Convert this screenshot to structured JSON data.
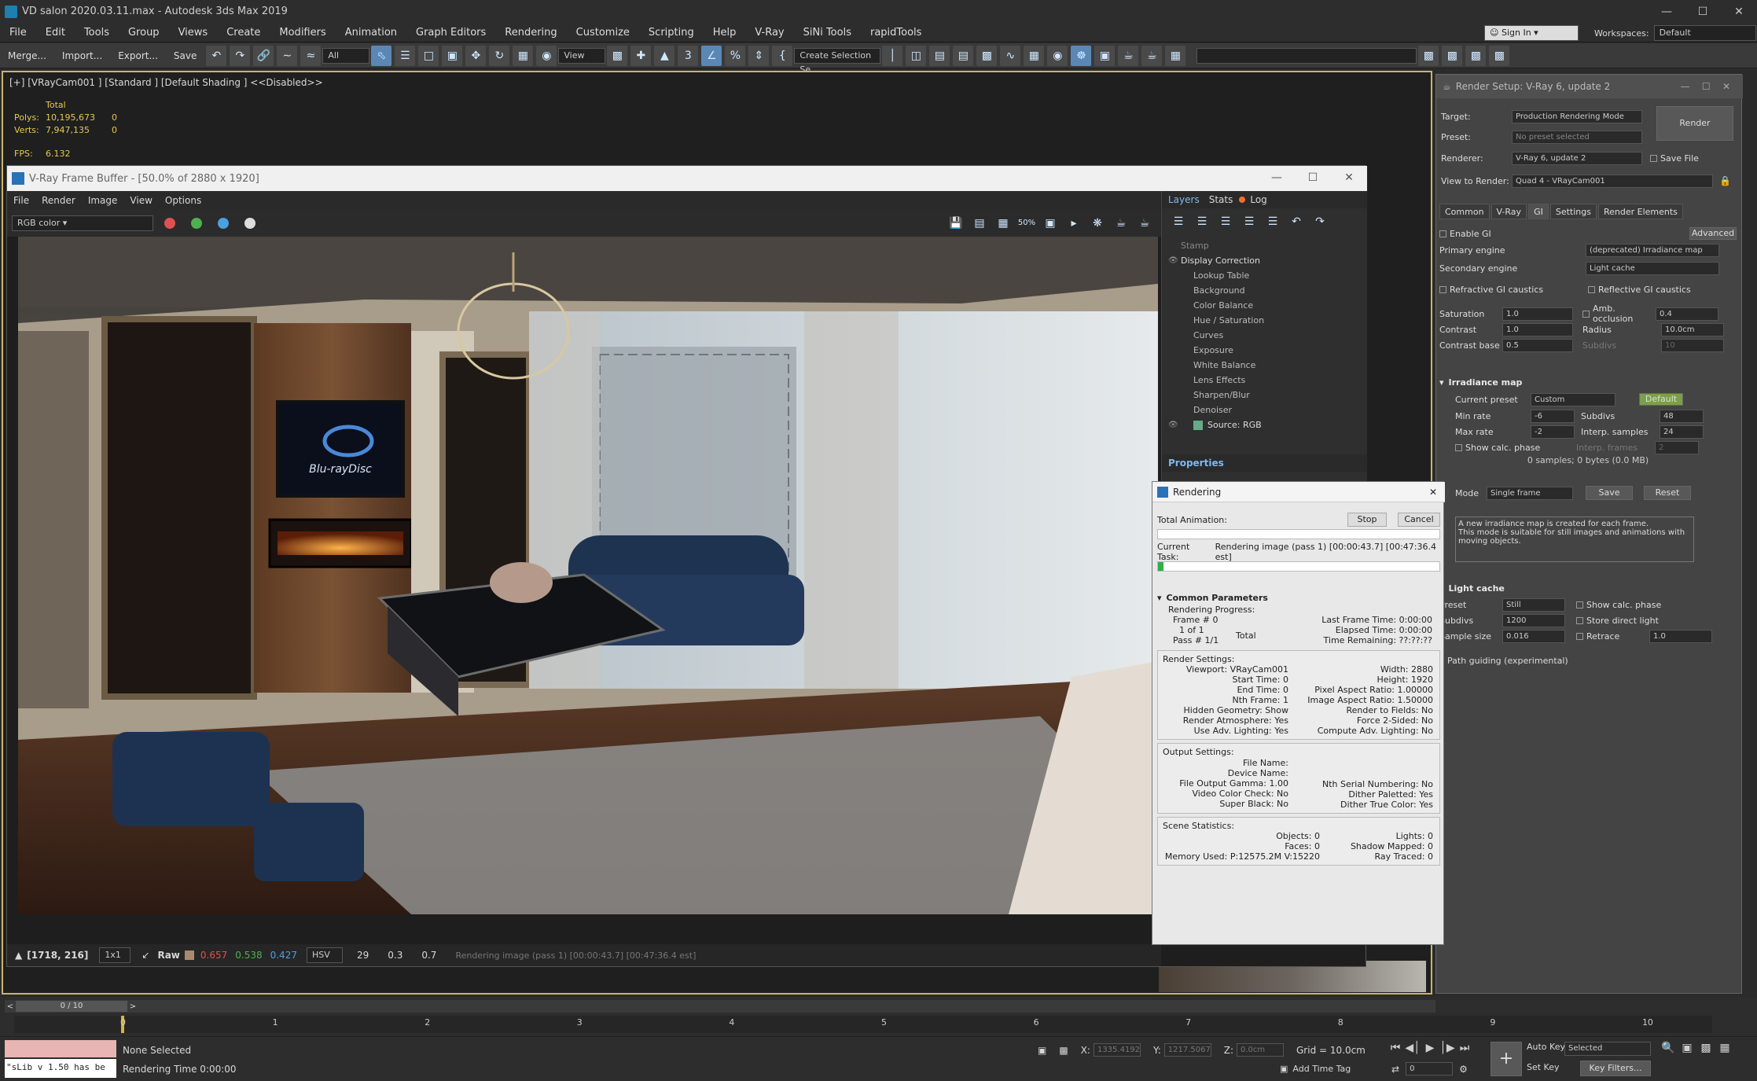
{
  "window": {
    "title": "VD salon 2020.03.11.max - Autodesk 3ds Max 2019",
    "controls": [
      "—",
      "☐",
      "✕"
    ]
  },
  "menu": [
    "File",
    "Edit",
    "Tools",
    "Group",
    "Views",
    "Create",
    "Modifiers",
    "Animation",
    "Graph Editors",
    "Rendering",
    "Customize",
    "Scripting",
    "Help",
    "V-Ray",
    "SiNi Tools",
    "rapidTools"
  ],
  "account": {
    "signin": "Sign In",
    "workspaces_label": "Workspaces:",
    "workspace": "Default"
  },
  "toolbar": {
    "merge": "Merge...",
    "import": "Import...",
    "export": "Export...",
    "save": "Save",
    "filter": "All",
    "refcoord": "View",
    "selset": "Create Selection Se"
  },
  "viewport": {
    "label": "[+] [VRayCam001 ] [Standard ] [Default Shading ]  <<Disabled>>",
    "stats": {
      "total": "Total",
      "polys_label": "Polys:",
      "polys": "10,195,673",
      "polys_sel": "0",
      "verts_label": "Verts:",
      "verts": "7,947,135",
      "verts_sel": "0",
      "fps_label": "FPS:",
      "fps": "6.132"
    }
  },
  "vfb": {
    "title": "V-Ray Frame Buffer - [50.0% of 2880 x 1920]",
    "menu": [
      "File",
      "Render",
      "Image",
      "View",
      "Options"
    ],
    "channel": "RGB color",
    "layer_tabs": [
      "Layers",
      "Stats",
      "Log"
    ],
    "layers": [
      "Stamp",
      "Display Correction",
      "Lookup Table",
      "Background",
      "Color Balance",
      "Hue / Saturation",
      "Curves",
      "Exposure",
      "White Balance",
      "Lens Effects",
      "Sharpen/Blur",
      "Denoiser",
      "Source: RGB"
    ],
    "properties": "Properties",
    "status": {
      "coords": "[1718, 216]",
      "zoom": "1x1",
      "mode": "Raw",
      "r": "0.657",
      "g": "0.538",
      "b": "0.427",
      "space": "HSV",
      "h": "29",
      "s": "0.3",
      "v": "0.7",
      "msg": "Rendering image (pass 1) [00:00:43.7] [00:47:36.4 est]"
    },
    "tv_text": "Blu-rayDisc"
  },
  "render_setup": {
    "title": "Render Setup: V-Ray 6, update 2",
    "target_label": "Target:",
    "target": "Production Rendering Mode",
    "preset_label": "Preset:",
    "preset": "No preset selected",
    "renderer_label": "Renderer:",
    "renderer": "V-Ray 6, update 2",
    "savefile": "Save File",
    "view_label": "View to Render:",
    "view": "Quad 4 - VRayCam001",
    "render_btn": "Render",
    "tabs": [
      "Common",
      "V-Ray",
      "GI",
      "Settings",
      "Render Elements"
    ],
    "gi": {
      "enable": "Enable GI",
      "advanced": "Advanced",
      "primary_label": "Primary engine",
      "primary": "(deprecated) Irradiance map",
      "secondary_label": "Secondary engine",
      "secondary": "Light cache",
      "refr": "Refractive GI caustics",
      "refl": "Reflective GI caustics",
      "saturation_label": "Saturation",
      "saturation": "1.0",
      "amb": "Amb. occlusion",
      "amb_val": "0.4",
      "contrast_label": "Contrast",
      "contrast": "1.0",
      "radius_label": "Radius",
      "radius": "10.0cm",
      "cbase_label": "Contrast base",
      "cbase": "0.5",
      "subdivs_dim": "Subdivs",
      "subdivs_dim_val": "10"
    },
    "irr": {
      "title": "Irradiance map",
      "preset_label": "Current preset",
      "preset": "Custom",
      "default": "Default",
      "min_label": "Min rate",
      "min": "-6",
      "subdivs_label": "Subdivs",
      "subdivs": "48",
      "max_label": "Max rate",
      "max": "-2",
      "interp_label": "Interp. samples",
      "interp": "24",
      "showcalc": "Show calc. phase",
      "frames_label": "Interp. frames",
      "frames": "2",
      "samples": "0 samples; 0 bytes (0.0 MB)",
      "mode_label": "Mode",
      "mode": "Single frame",
      "save": "Save",
      "reset": "Reset",
      "desc": "A new irradiance map is created for each frame.\nThis mode is suitable for still images and animations with moving objects."
    },
    "lc": {
      "title": "Light cache",
      "preset_label": "Preset",
      "preset": "Still",
      "showcalc": "Show calc. phase",
      "subdivs_label": "Subdivs",
      "subdivs": "1200",
      "store": "Store direct light",
      "size_label": "Sample size",
      "size": "0.016",
      "retrace": "Retrace",
      "retrace_val": "1.0"
    },
    "pathguide": "Path guiding (experimental)"
  },
  "rendering": {
    "title": "Rendering",
    "total_anim": "Total Animation:",
    "stop": "Stop",
    "cancel": "Cancel",
    "current_task_label": "Current Task:",
    "current_task": "Rendering image (pass 1) [00:00:43.7] [00:47:36.4 est]",
    "progress": 0.02,
    "common": "Common Parameters",
    "progress_label": "Rendering Progress:",
    "frame": "Frame #  0",
    "oneof": "1 of 1",
    "total": "Total",
    "pass": "Pass #  1/1",
    "last_frame": "Last Frame Time:  0:00:00",
    "elapsed": "Elapsed Time:  0:00:00",
    "remaining": "Time Remaining:  ??:??:??",
    "render_settings": "Render Settings:",
    "rs_left": [
      "Viewport:  VRayCam001",
      "Start Time:  0",
      "End Time:  0",
      "Nth Frame:  1",
      "Hidden Geometry:  Show",
      "Render Atmosphere:  Yes",
      "Use Adv. Lighting:  Yes"
    ],
    "rs_right": [
      "Width:  2880",
      "Height:  1920",
      "Pixel Aspect Ratio:  1.00000",
      "Image Aspect Ratio:  1.50000",
      "Render to Fields:  No",
      "Force 2-Sided:  No",
      "Compute Adv. Lighting:  No"
    ],
    "output": "Output Settings:",
    "os_left": [
      "File Name:",
      "Device Name:",
      "File Output Gamma:  1.00",
      "Video Color Check:  No",
      "Super Black:  No"
    ],
    "os_right": [
      "",
      "",
      "Nth Serial Numbering:  No",
      "Dither Paletted:  Yes",
      "Dither True Color:  Yes"
    ],
    "scene": "Scene Statistics:",
    "ss_left": [
      "Objects:  0",
      "Faces:  0",
      "Memory Used:  P:12575.2M V:15220"
    ],
    "ss_right": [
      "Lights:  0",
      "Shadow Mapped:  0",
      "Ray Traced:  0"
    ]
  },
  "timeline": {
    "frame": "0 / 10",
    "ticks": [
      "0",
      "1",
      "2",
      "3",
      "4",
      "5",
      "6",
      "7",
      "8",
      "9",
      "10"
    ]
  },
  "status": {
    "script": "\"sLib v 1.50 has be",
    "selection": "None Selected",
    "render_time": "Rendering Time  0:00:00",
    "x_label": "X:",
    "x": "1335.4192",
    "y_label": "Y:",
    "y": "1217.5067",
    "z_label": "Z:",
    "z": "0.0cm",
    "grid": "Grid = 10.0cm",
    "timetag": "Add Time Tag",
    "autokey": "Auto Key",
    "setkey": "Set Key",
    "selected": "Selected",
    "keyfilters": "Key Filters...",
    "spinner": "0"
  },
  "colors": {
    "accent": "#5b87b5",
    "viewport_border": "#c9b56b",
    "stats": "#e6c84f",
    "red": "#e05050",
    "green": "#4fb04f",
    "blue": "#4aa0e0"
  }
}
